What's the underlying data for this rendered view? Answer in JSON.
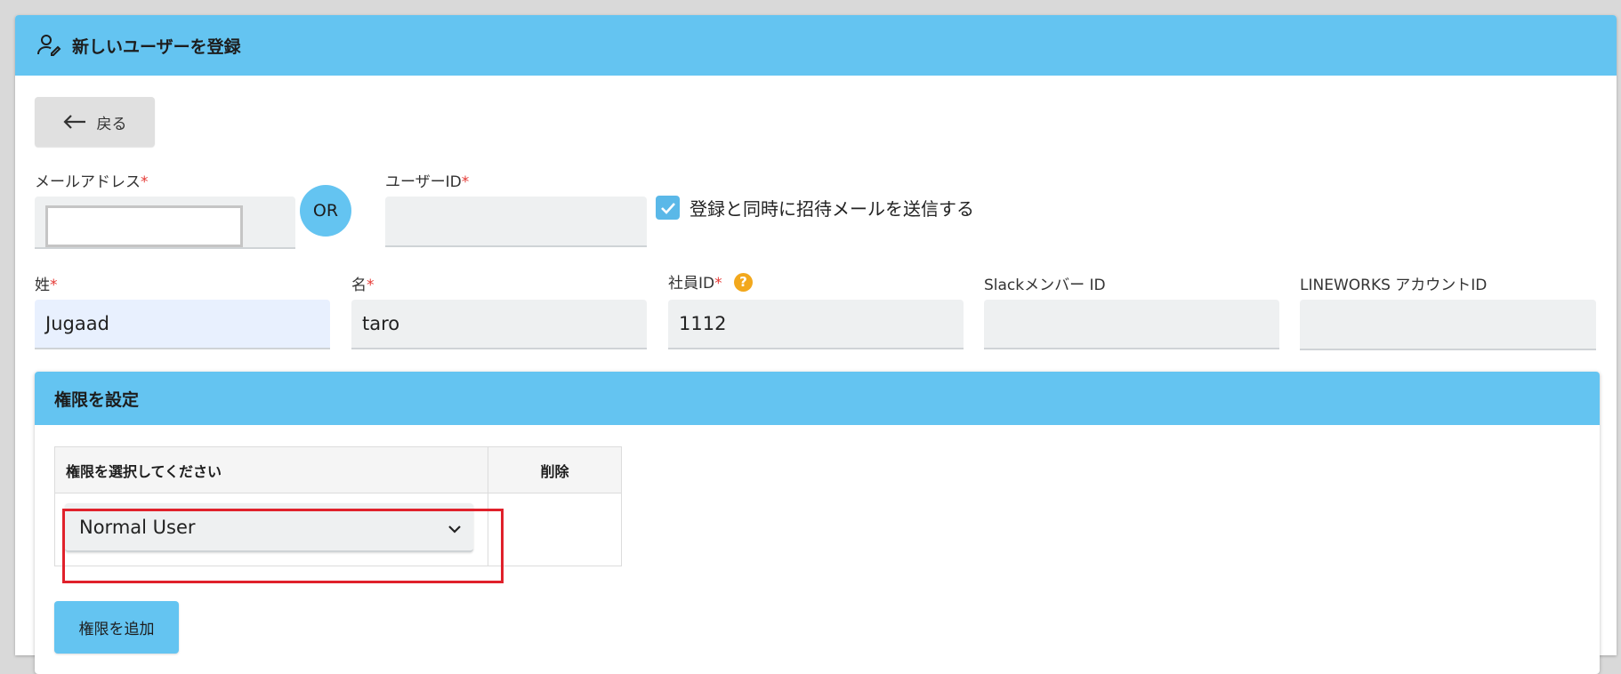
{
  "header": {
    "title": "新しいユーザーを登録",
    "icon": "user-edit-icon"
  },
  "back_button": {
    "label": "戻る",
    "icon": "arrow-left-icon"
  },
  "email": {
    "label": "メールアドレス",
    "required": "*",
    "value": ""
  },
  "or_label": "OR",
  "user_id": {
    "label": "ユーザーID",
    "required": "*",
    "value": ""
  },
  "send_invite": {
    "label": "登録と同時に招待メールを送信する",
    "checked": true
  },
  "last_name": {
    "label": "姓",
    "required": "*",
    "value": "Jugaad"
  },
  "first_name": {
    "label": "名",
    "required": "*",
    "value": "taro"
  },
  "employee_id": {
    "label": "社員ID",
    "required": "*",
    "value": "1112",
    "help": "?"
  },
  "slack_id": {
    "label": "Slackメンバー ID",
    "value": ""
  },
  "lineworks_id": {
    "label": "LINEWORKS アカウントID",
    "value": ""
  },
  "permissions": {
    "title": "権限を設定",
    "col_select": "権限を選択してください",
    "col_delete": "削除",
    "selected_role": "Normal User",
    "add_button": "権限を追加"
  },
  "colors": {
    "accent": "#64c4f1",
    "required": "#e53935",
    "highlight": "#e0212b",
    "help": "#f2a81d"
  }
}
